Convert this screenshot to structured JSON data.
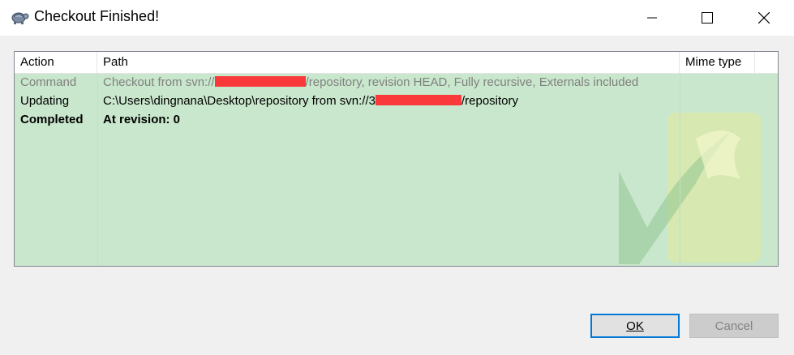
{
  "window": {
    "title": "Checkout Finished!",
    "controls": {
      "minimize": "minimize",
      "maximize": "maximize",
      "close": "close"
    }
  },
  "list": {
    "columns": [
      "Action",
      "Path",
      "Mime type"
    ],
    "rows": [
      {
        "action": "Command",
        "path_before": "Checkout from svn://",
        "path_after": "/repository, revision HEAD, Fully recursive, Externals included",
        "style": "dim"
      },
      {
        "action": "Updating",
        "path_before": "C:\\Users\\dingnana\\Desktop\\repository from svn://",
        "path_mid": "3",
        "path_after": "/repository",
        "style": "normal"
      },
      {
        "action": "Completed",
        "path_before": "At revision: 0",
        "style": "bold"
      }
    ],
    "background_color": "#c9e7cc",
    "redaction_color": "#fa3a3a"
  },
  "buttons": {
    "ok": "OK",
    "cancel": "Cancel"
  },
  "colors": {
    "focus_border": "#0078d7"
  }
}
